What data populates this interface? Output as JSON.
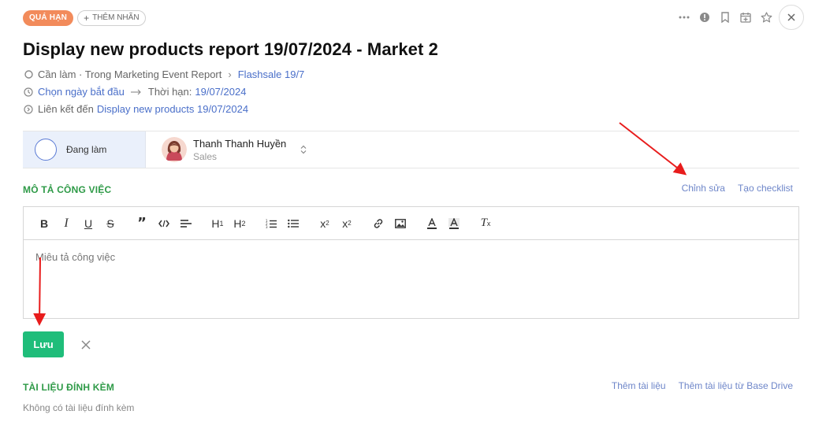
{
  "topbar": {
    "overdue_badge": "QUÁ HẠN",
    "add_tag_label": "THÊM NHÃN",
    "icons": [
      "more-dots-icon",
      "alert-icon",
      "bookmark-icon",
      "calendar-add-icon",
      "star-icon",
      "close-icon"
    ]
  },
  "task": {
    "title": "Display new products report 19/07/2024 - Market 2",
    "status_text": "Cần làm · Trong Marketing Event Report",
    "breadcrumb_link": "Flashsale 19/7",
    "start_date_label": "Chọn ngày bắt đầu",
    "deadline_label": "Thời hạn:",
    "deadline_value": "19/07/2024",
    "linked_label": "Liên kết đến",
    "linked_value": "Display new products 19/07/2024"
  },
  "status": {
    "label": "Đang làm"
  },
  "assignee": {
    "name": "Thanh Thanh Huyền",
    "role": "Sales"
  },
  "description": {
    "section_title": "MÔ TẢ CÔNG VIỆC",
    "edit_link": "Chỉnh sửa",
    "checklist_link": "Tạo checklist",
    "placeholder": "Miêu tả công việc",
    "save_label": "Lưu"
  },
  "attachments": {
    "section_title": "TÀI LIỆU ĐÍNH KÈM",
    "add_link": "Thêm tài liệu",
    "add_drive_link": "Thêm tài liệu từ Base Drive",
    "empty_text": "Không có tài liệu đính kèm"
  },
  "colors": {
    "overdue": "#f28b5b",
    "accent_green": "#2e9a47",
    "save_button": "#1fbd7a",
    "link_blue": "#4a6fc9",
    "annotation_red": "#e81c1c"
  }
}
